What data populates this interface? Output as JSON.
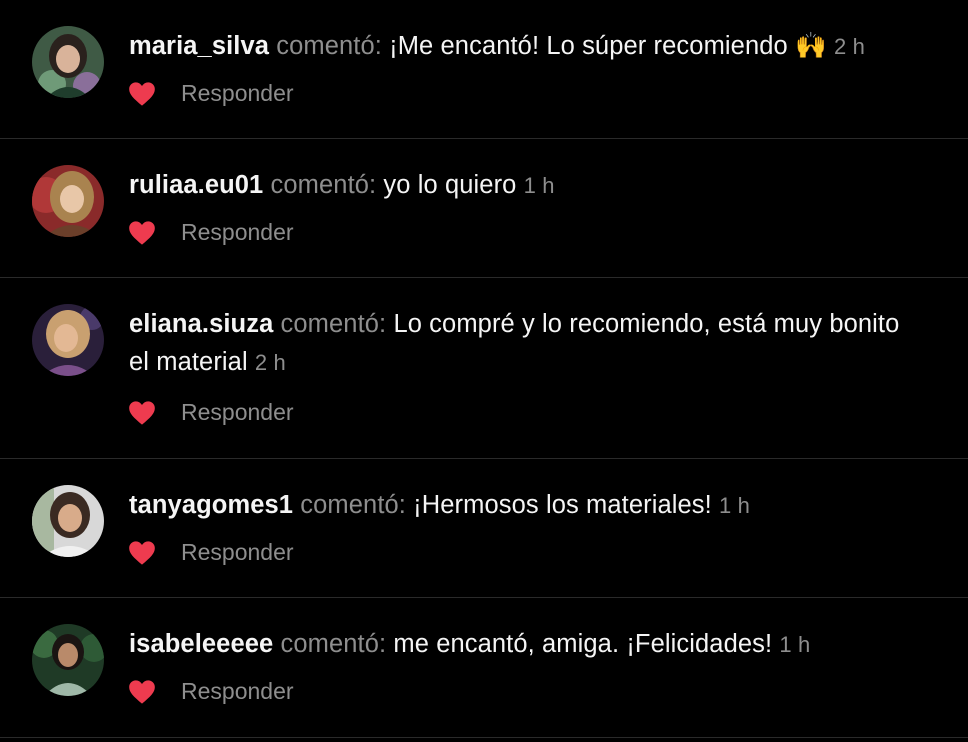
{
  "ui": {
    "verb": "comentó:",
    "reply_label": "Responder",
    "icons": {
      "like": "heart-icon",
      "avatar": "user-avatar"
    },
    "colors": {
      "background": "#000000",
      "text": "#f5f5f5",
      "muted": "#8e8e8e",
      "heart": "#ee3b4f",
      "divider": "#2a2a2a"
    }
  },
  "comments": [
    {
      "username": "maria_silva",
      "text": "¡Me encantó! Lo súper recomiendo 🙌",
      "time": "2 h"
    },
    {
      "username": "ruliaa.eu01",
      "text": "yo lo quiero",
      "time": "1 h"
    },
    {
      "username": "eliana.siuza",
      "text": "Lo compré y lo recomiendo, está muy bonito el material",
      "time": "2 h"
    },
    {
      "username": "tanyagomes1",
      "text": "¡Hermosos los materiales!",
      "time": "1 h"
    },
    {
      "username": "isabeleeeee",
      "text": "me encantó, amiga. ¡Felicidades!",
      "time": "1 h"
    }
  ]
}
